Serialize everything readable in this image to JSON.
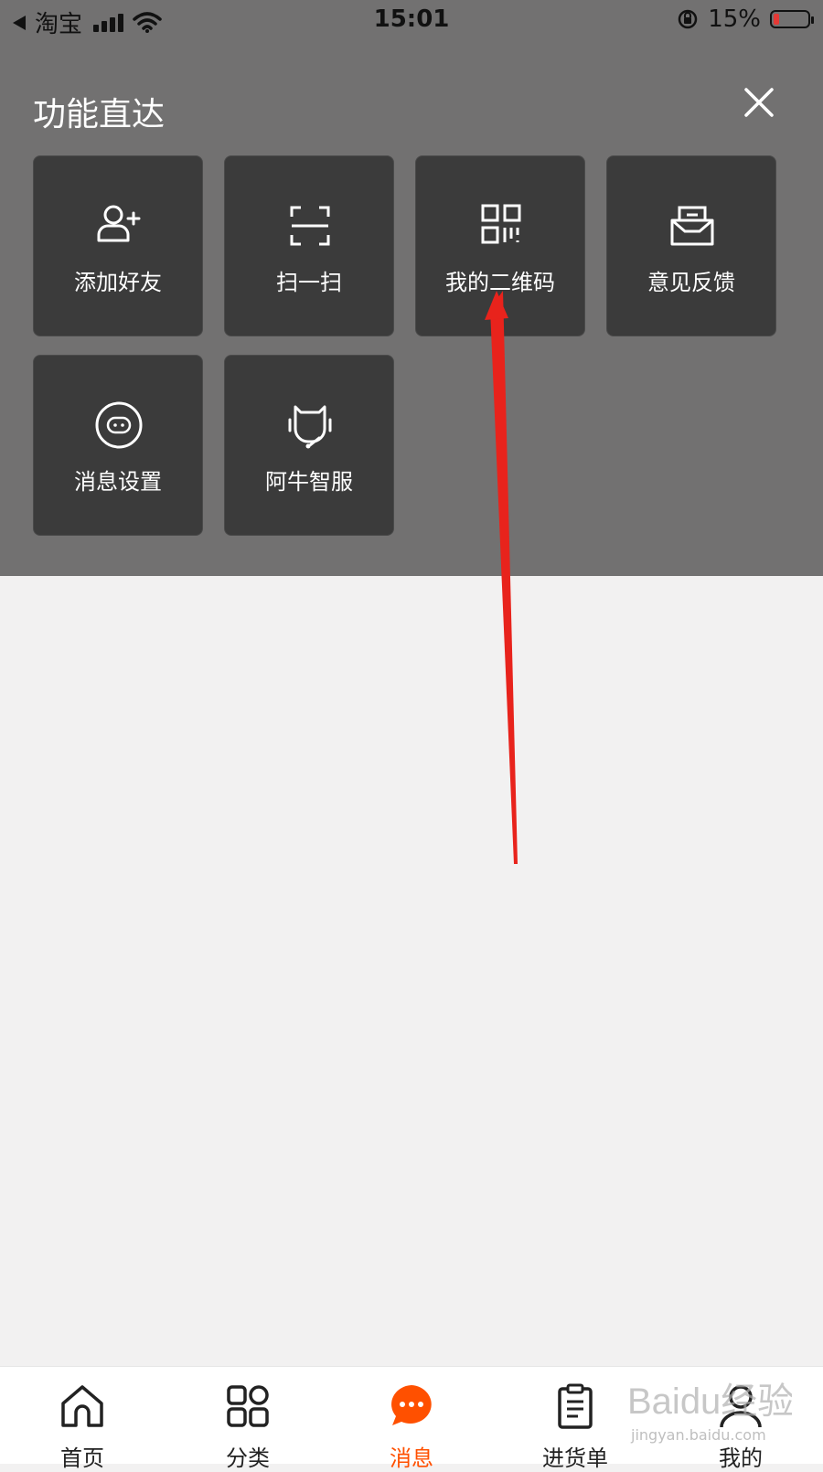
{
  "status_bar": {
    "carrier": "淘宝",
    "time": "15:01",
    "battery_percent": "15%",
    "icons": [
      "back-arrow-icon",
      "signal-icon",
      "wifi-icon",
      "rotation-lock-icon",
      "battery-icon"
    ]
  },
  "panel": {
    "title": "功能直达",
    "close_icon": "close-icon",
    "tiles": [
      {
        "label": "添加好友",
        "icon": "add-friend-icon"
      },
      {
        "label": "扫一扫",
        "icon": "scan-icon"
      },
      {
        "label": "我的二维码",
        "icon": "qr-code-icon"
      },
      {
        "label": "意见反馈",
        "icon": "feedback-icon"
      },
      {
        "label": "消息设置",
        "icon": "message-settings-icon"
      },
      {
        "label": "阿牛智服",
        "icon": "customer-service-icon"
      }
    ]
  },
  "tab_bar": {
    "items": [
      {
        "label": "首页",
        "icon": "home-icon"
      },
      {
        "label": "分类",
        "icon": "category-icon"
      },
      {
        "label": "消息",
        "icon": "message-icon",
        "active": true
      },
      {
        "label": "进货单",
        "icon": "clipboard-icon"
      },
      {
        "label": "我的",
        "icon": "profile-icon"
      }
    ]
  },
  "colors": {
    "overlay": "#727171",
    "tile": "#3b3b3b",
    "accent": "#ff5000",
    "annotation_arrow": "#e8231c",
    "background": "#f2f1f1"
  },
  "watermark": {
    "text": "Baidu经验",
    "sub": "jingyan.baidu.com"
  }
}
